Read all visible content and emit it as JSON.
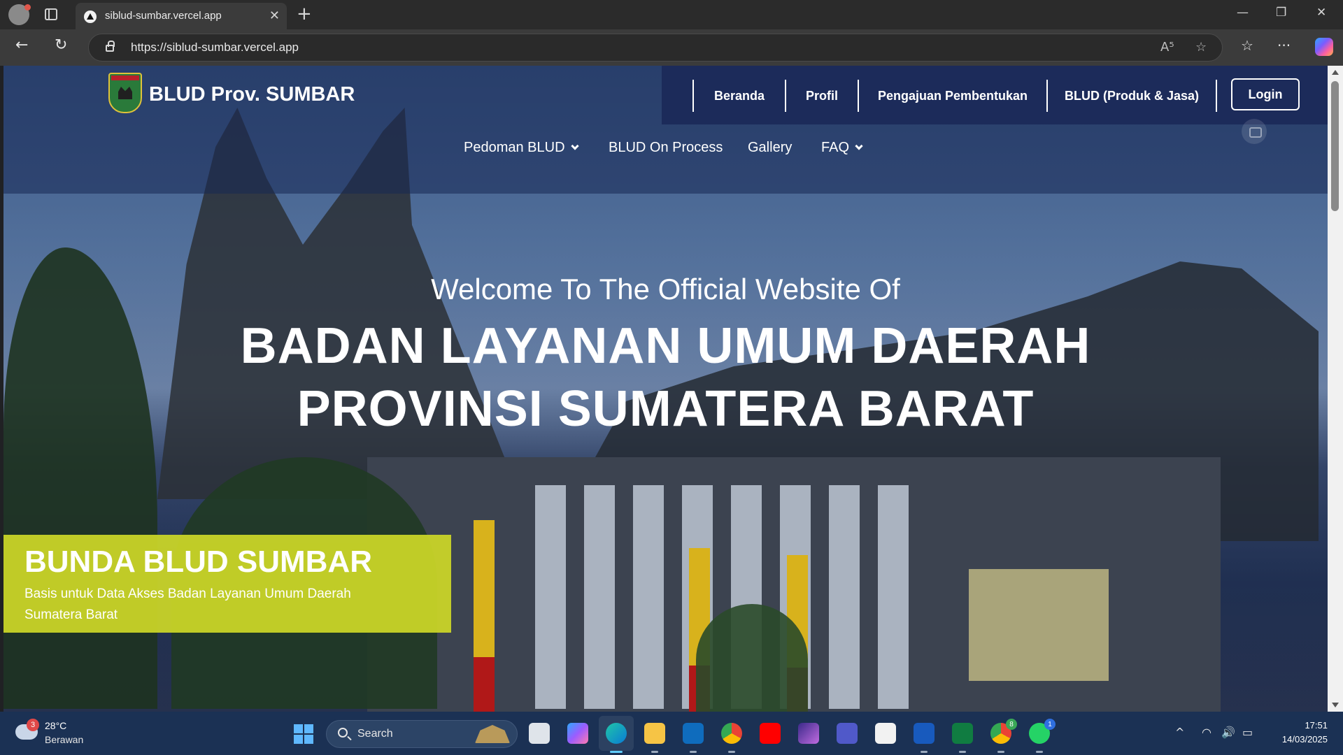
{
  "browser": {
    "tab": {
      "title": "siblud-sumbar.vercel.app",
      "close_glyph": "✕"
    },
    "new_tab_glyph": "+",
    "window_controls": {
      "minimize": "—",
      "restore": "❐",
      "close": "✕"
    },
    "toolbar": {
      "back_glyph": "←",
      "reload_glyph": "↻",
      "read_aloud_glyph": "A⁵",
      "favorite_glyph": "☆",
      "favorites_glyph": "☆",
      "more_glyph": "···"
    },
    "url": "https://siblud-sumbar.vercel.app"
  },
  "site": {
    "brand": "BLUD Prov. SUMBAR",
    "top_nav": [
      {
        "label": "Beranda"
      },
      {
        "label": "Profil"
      },
      {
        "label": "Pengajuan Pembentukan"
      },
      {
        "label": "BLUD (Produk & Jasa)"
      }
    ],
    "login_label": "Login",
    "sub_nav": [
      {
        "label": "Pedoman BLUD",
        "has_dropdown": true
      },
      {
        "label": "BLUD On Process",
        "has_dropdown": false
      },
      {
        "label": "Gallery",
        "has_dropdown": false
      },
      {
        "label": "FAQ",
        "has_dropdown": true
      }
    ],
    "hero": {
      "subtitle": "Welcome To The Official Website Of",
      "title_line1": "BADAN LAYANAN UMUM DAERAH",
      "title_line2": "PROVINSI SUMATERA BARAT"
    },
    "promo": {
      "title": "BUNDA BLUD SUMBAR",
      "text": "Basis untuk Data Akses Badan Layanan Umum Daerah Sumatera Barat"
    },
    "colors": {
      "nav_bg": "#1c2b5a",
      "promo_bg": "#ccd728"
    }
  },
  "taskbar": {
    "weather": {
      "badge": "3",
      "temp": "28°C",
      "condition": "Berawan"
    },
    "search_label": "Search",
    "apps": [
      {
        "name": "task-view-icon"
      },
      {
        "name": "copilot-icon"
      },
      {
        "name": "edge-icon"
      },
      {
        "name": "file-explorer-icon"
      },
      {
        "name": "outlook-icon"
      },
      {
        "name": "chrome-icon"
      },
      {
        "name": "youtube-icon"
      },
      {
        "name": "app-icon"
      },
      {
        "name": "teams-icon"
      },
      {
        "name": "store-icon"
      },
      {
        "name": "word-icon"
      },
      {
        "name": "excel-icon"
      },
      {
        "name": "chrome-profile-icon",
        "badge": "8"
      },
      {
        "name": "whatsapp-icon",
        "badge": "1"
      }
    ],
    "tray": {
      "chevron": "^",
      "wifi": "◠",
      "volume": "🔊",
      "battery": "▭"
    },
    "clock": {
      "time": "17:51",
      "date": "14/03/2025"
    }
  }
}
